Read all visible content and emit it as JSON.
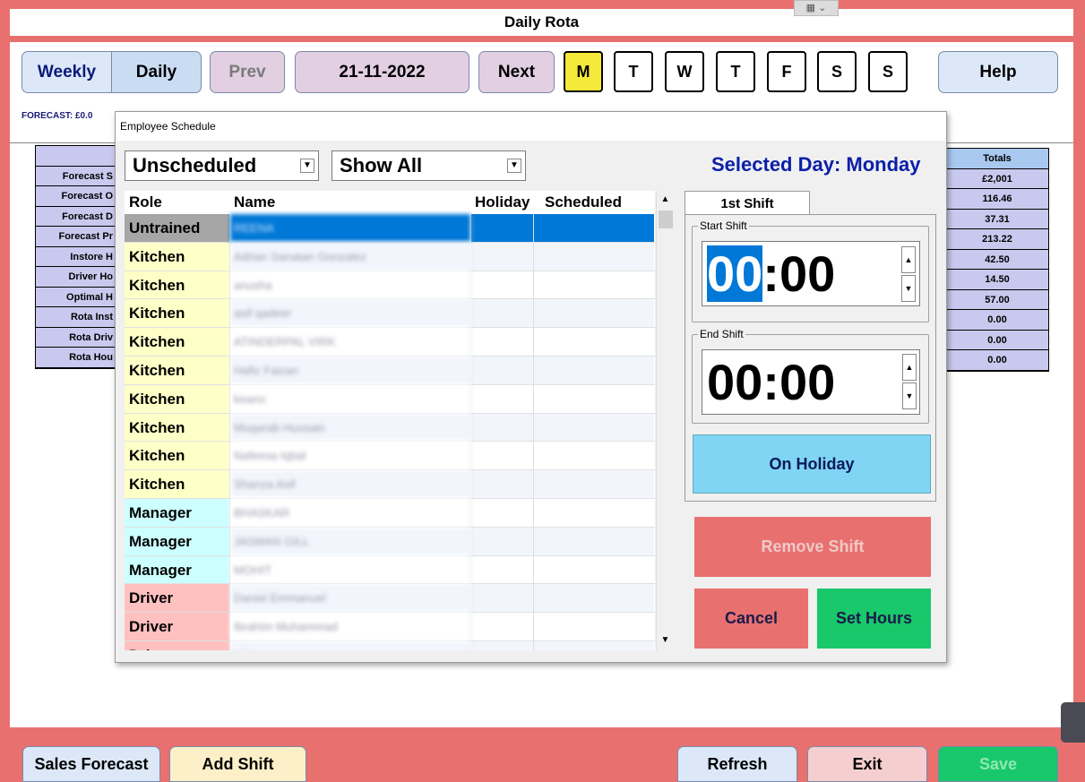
{
  "window_title": "Daily Rota",
  "toolbar": {
    "weekly": "Weekly",
    "daily": "Daily",
    "prev": "Prev",
    "date": "21-11-2022",
    "next": "Next",
    "days": [
      "M",
      "T",
      "W",
      "T",
      "F",
      "S",
      "S"
    ],
    "help": "Help"
  },
  "forecast_label": "FORECAST: £0.0",
  "bg_rows": [
    "Forecast S",
    "Forecast O",
    "Forecast D",
    "Forecast Pr",
    "Instore H",
    "Driver Ho",
    "Optimal H",
    "Rota Inst",
    "Rota Driv",
    "Rota Hou"
  ],
  "totals": {
    "header": "Totals",
    "values": [
      "£2,001",
      "116.46",
      "37.31",
      "213.22",
      "42.50",
      "14.50",
      "57.00",
      "0.00",
      "0.00",
      "0.00"
    ]
  },
  "dialog": {
    "title": "Employee Schedule",
    "filter1": "Unscheduled",
    "filter2": "Show All",
    "selected_day": "Selected Day: Monday",
    "columns": {
      "role": "Role",
      "name": "Name",
      "holiday": "Holiday",
      "scheduled": "Scheduled"
    },
    "rows": [
      {
        "role": "Untrained",
        "name": "REENA",
        "color": "#a6a6a6"
      },
      {
        "role": "Kitchen",
        "name": "Adrian Sanatan Gonzalez",
        "color": "#ffffc8"
      },
      {
        "role": "Kitchen",
        "name": "anusha",
        "color": "#ffffc8"
      },
      {
        "role": "Kitchen",
        "name": "asif qadeer",
        "color": "#ffffc8"
      },
      {
        "role": "Kitchen",
        "name": "ATINDERPAL VIRK",
        "color": "#ffffc8"
      },
      {
        "role": "Kitchen",
        "name": "Hafiz Faizan",
        "color": "#ffffc8"
      },
      {
        "role": "Kitchen",
        "name": "keano",
        "color": "#ffffc8"
      },
      {
        "role": "Kitchen",
        "name": "Muqarab Hussain",
        "color": "#ffffc8"
      },
      {
        "role": "Kitchen",
        "name": "Nafeesa Iqbal",
        "color": "#ffffc8"
      },
      {
        "role": "Kitchen",
        "name": "Shanza Asif",
        "color": "#ffffc8"
      },
      {
        "role": "Manager",
        "name": "BHASKAR",
        "color": "#ccffff"
      },
      {
        "role": "Manager",
        "name": "JASMAN GILL",
        "color": "#ccffff"
      },
      {
        "role": "Manager",
        "name": "MOHIT",
        "color": "#ccffff"
      },
      {
        "role": "Driver",
        "name": "Daniel Emmanuel",
        "color": "#ffc0c0"
      },
      {
        "role": "Driver",
        "name": "Ibrahim Muhammad",
        "color": "#ffc0c0"
      },
      {
        "role": "Driver",
        "name": "Irfan",
        "color": "#ffc0c0"
      }
    ],
    "tab": "1st Shift",
    "start_label": "Start Shift",
    "start_hh": "00",
    "start_mm": ":00",
    "end_label": "End Shift",
    "end_time": "00:00",
    "on_holiday": "On Holiday",
    "remove_shift": "Remove Shift",
    "cancel": "Cancel",
    "set_hours": "Set Hours"
  },
  "bottom": {
    "sales_forecast": "Sales Forecast",
    "add_shift": "Add Shift",
    "refresh": "Refresh",
    "exit": "Exit",
    "save": "Save"
  }
}
